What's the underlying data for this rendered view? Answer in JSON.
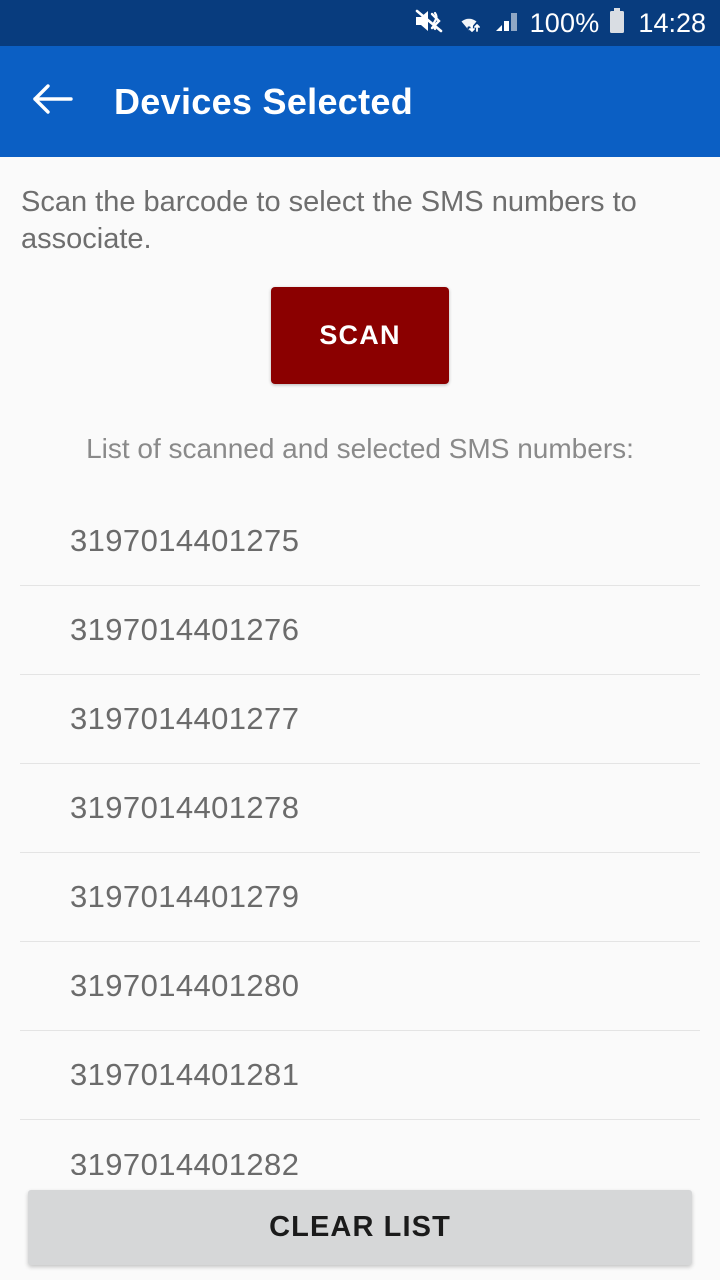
{
  "status_bar": {
    "background": "#083c7e",
    "battery_percent": "100%",
    "time": "14:28",
    "icons": [
      "mute-vibrate-icon",
      "wifi-icon",
      "signal-icon",
      "battery-icon"
    ]
  },
  "app_bar": {
    "background": "#0b5fc4",
    "back_label": "back-arrow",
    "title": "Devices Selected"
  },
  "main": {
    "instructions": "Scan the barcode to select the SMS numbers to associate.",
    "scan_button_label": "SCAN",
    "scan_button_color": "#8b0000",
    "list_heading": "List of scanned and selected SMS numbers:",
    "sms_numbers": [
      "3197014401275",
      "3197014401276",
      "3197014401277",
      "3197014401278",
      "3197014401279",
      "3197014401280",
      "3197014401281",
      "3197014401282"
    ]
  },
  "footer": {
    "clear_button_label": "CLEAR LIST",
    "clear_button_color": "#d6d7d8"
  }
}
